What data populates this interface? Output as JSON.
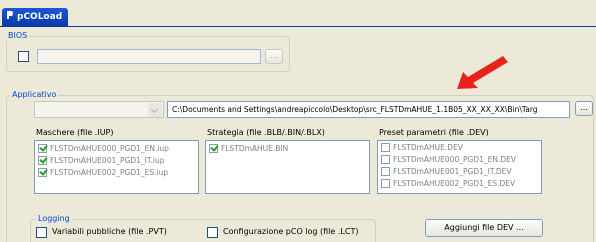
{
  "window": {
    "tab_title": "pCOLoad",
    "accent_color": "#0046d5"
  },
  "bios": {
    "label": "BIOS",
    "checked": false,
    "path_value": "",
    "browse_label": "..."
  },
  "applicativo": {
    "label": "Applicativo",
    "combo_value": "",
    "path_value": "C:\\Documents and Settings\\andreapiccolo\\Desktop\\src_FLSTDmAHUE_1.1B05_XX_XX_XX\\Bin\\Targ",
    "browse_label": "...",
    "maschere": {
      "title": "Maschere (file .IUP)",
      "items": [
        {
          "label": "FLSTDmAHUE000_PGD1_EN.iup",
          "checked": true
        },
        {
          "label": "FLSTDmAHUE001_PGD1_IT.iup",
          "checked": true
        },
        {
          "label": "FLSTDmAHUE002_PGD1_ES.iup",
          "checked": true
        }
      ]
    },
    "strategia": {
      "title": "Strategia (file .BLB/.BIN/.BLX)",
      "items": [
        {
          "label": "FLSTDmAHUE.BIN",
          "checked": true
        }
      ]
    },
    "preset": {
      "title": "Preset parametri (file .DEV)",
      "items": [
        {
          "label": "FLSTDmAHUE.DEV",
          "checked": false
        },
        {
          "label": "FLSTDmAHUE000_PGD1_EN.DEV",
          "checked": false
        },
        {
          "label": "FLSTDmAHUE001_PGD1_IT.DEV",
          "checked": false
        },
        {
          "label": "FLSTDmAHUE002_PGD1_ES.DEV",
          "checked": false
        }
      ]
    }
  },
  "logging": {
    "label": "Logging",
    "variabili": {
      "label": "Variabili pubbliche (file .PVT)",
      "checked": false
    },
    "configurazione": {
      "label": "Configurazione pCO log (file .LCT)",
      "checked": false
    }
  },
  "aggiungi_button": "Aggiungi file DEV ...",
  "annotation": {
    "arrow_color": "#e8231c",
    "icon": "red-arrow-pointing-to-path"
  }
}
